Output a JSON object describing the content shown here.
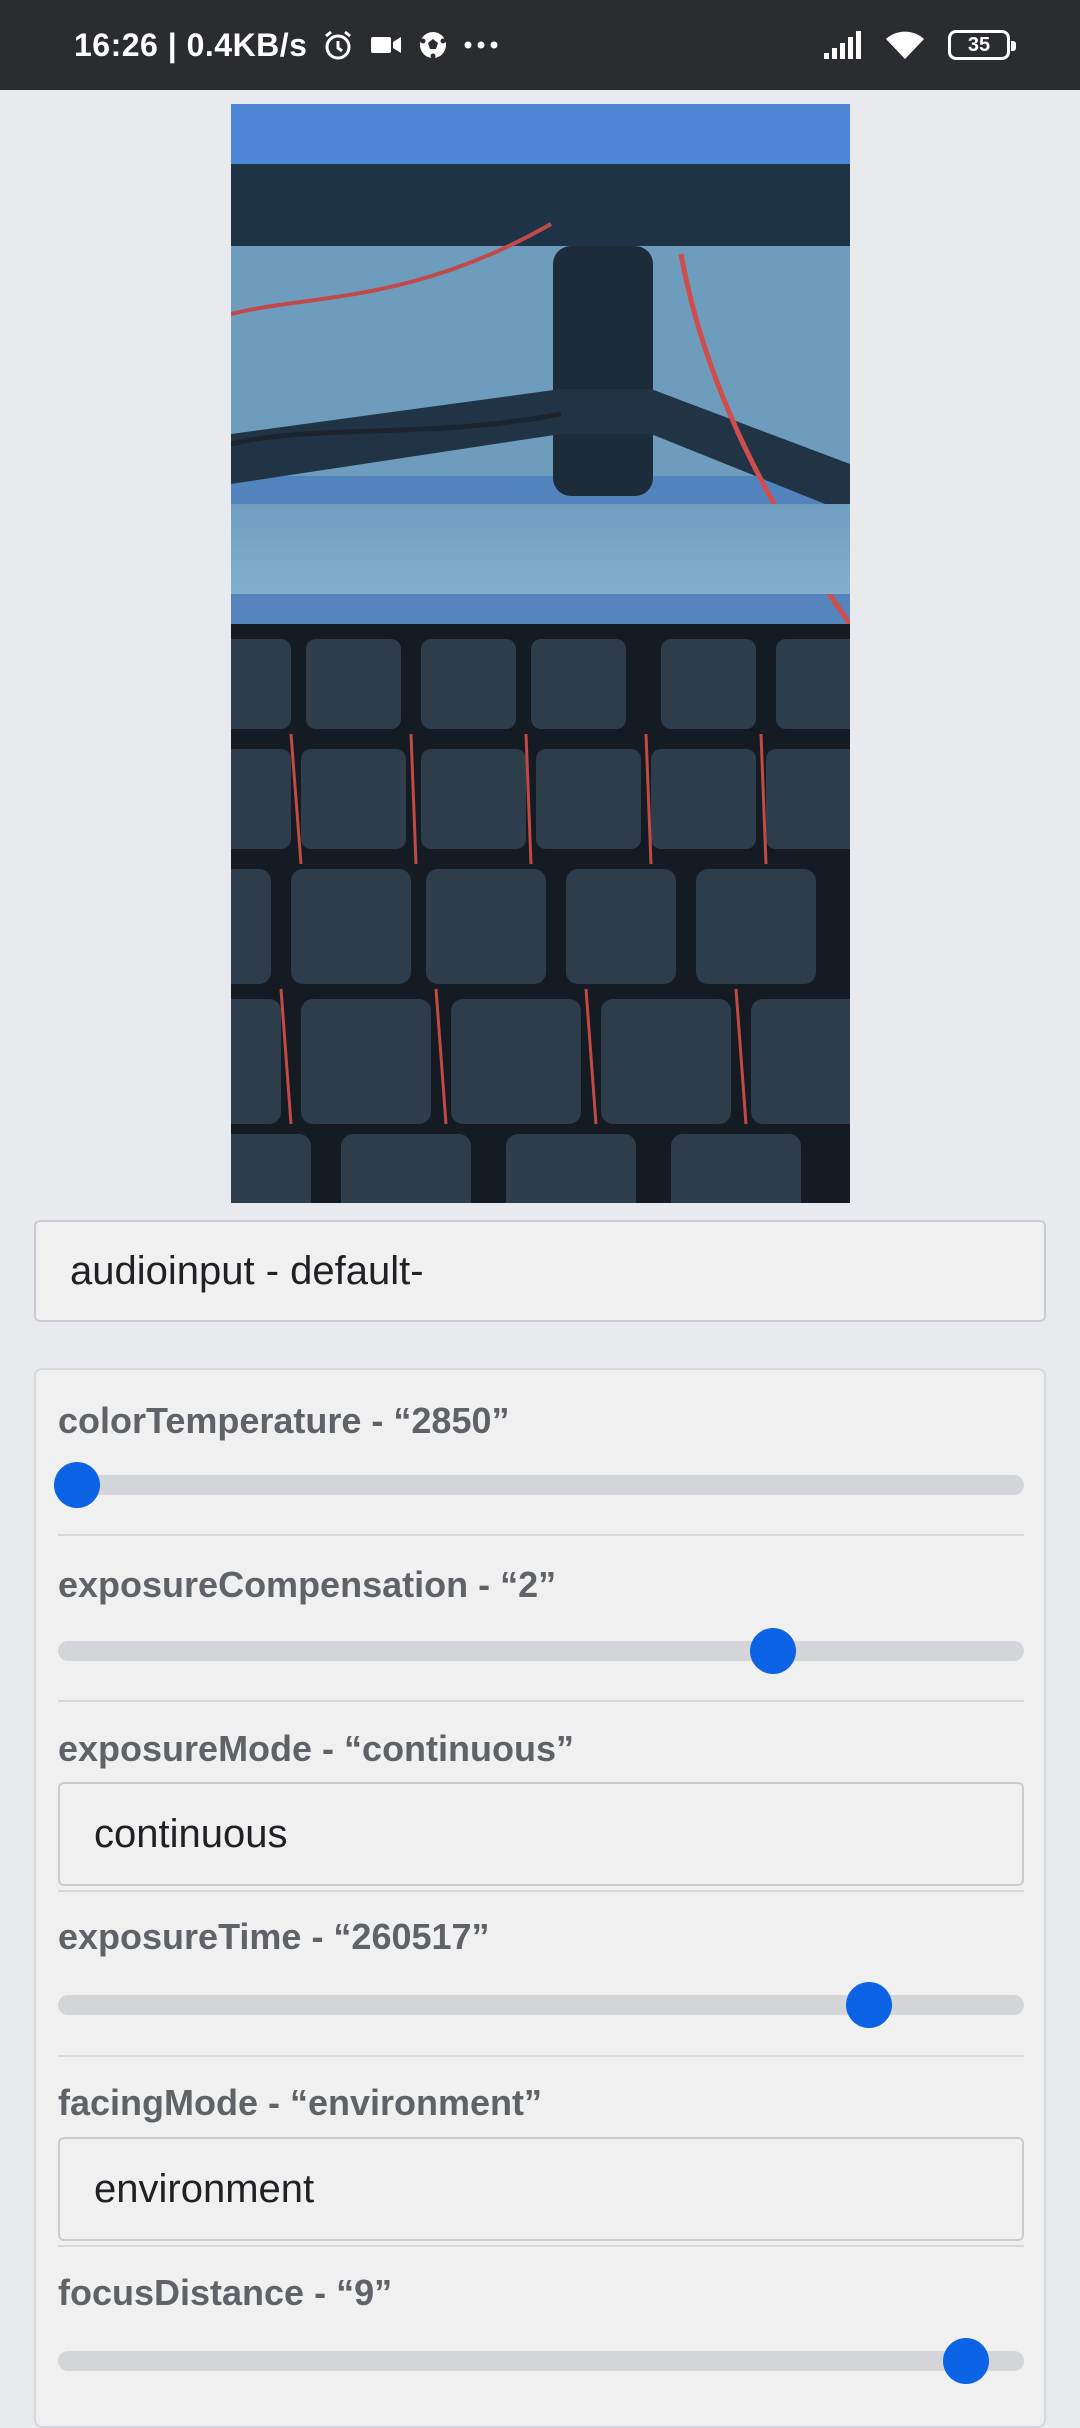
{
  "status_bar": {
    "time_speed": "16:26 | 0.4KB/s",
    "battery": "35"
  },
  "device_select": {
    "value": "audioinput - default-"
  },
  "controls": {
    "colorTemperature": {
      "label": "colorTemperature - “2850”",
      "fraction": 0.02
    },
    "exposureCompensation": {
      "label": "exposureCompensation - “2”",
      "fraction": 0.74
    },
    "exposureMode": {
      "label": "exposureMode - “continuous”",
      "value": "continuous"
    },
    "exposureTime": {
      "label": "exposureTime - “260517”",
      "fraction": 0.84
    },
    "facingMode": {
      "label": "facingMode - “environment”",
      "value": "environment"
    },
    "focusDistance": {
      "label": "focusDistance - “9”",
      "fraction": 0.94
    }
  }
}
